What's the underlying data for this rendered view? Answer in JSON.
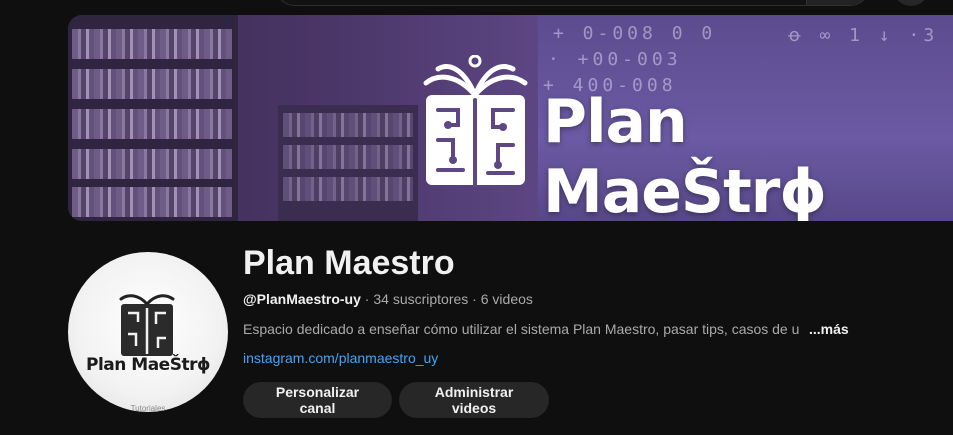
{
  "banner": {
    "brand_text": "Plan MaeŠtrɸ",
    "board_lines": [
      "+ 0-008 0 0",
      "· +00-003",
      "+ 400-008",
      "ꝋ ∞ 1 ↓ ·3"
    ]
  },
  "avatar": {
    "brand_text": "Plan MaeŠtrɸ",
    "sub_text": "Tutoriales"
  },
  "channel": {
    "title": "Plan Maestro",
    "handle": "@PlanMaestro-uy",
    "separator": " · ",
    "subscribers": "34 suscriptores",
    "videos": "6 videos",
    "description": "Espacio dedicado a enseñar cómo utilizar el sistema Plan Maestro, pasar  tips, casos de u",
    "more_label": "...más",
    "link": "instagram.com/planmaestro_uy"
  },
  "actions": {
    "customize_label": "Personalizar canal",
    "manage_label": "Administrar videos"
  },
  "colors": {
    "background": "#0f0f0f",
    "link": "#3ea6ff",
    "button_bg": "#272727",
    "banner_purple": "#5e4785"
  }
}
